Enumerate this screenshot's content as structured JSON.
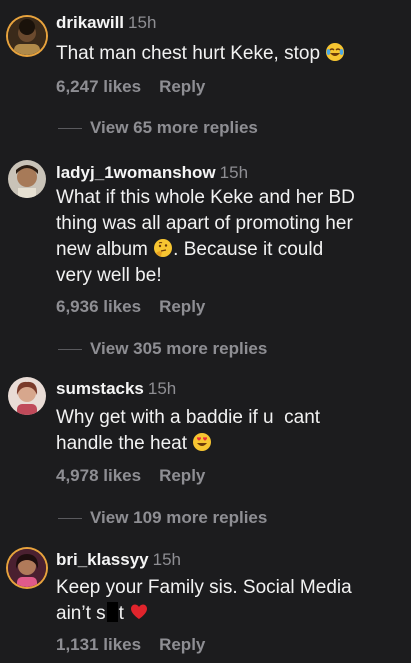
{
  "comments": [
    {
      "username": "drikawill",
      "time": "15h",
      "text": "That man chest hurt Keke, stop",
      "emoji": "face-with-tears-of-joy",
      "likes": "6,247 likes",
      "reply": "Reply",
      "view_more": "View 65 more replies"
    },
    {
      "username": "ladyj_1womanshow",
      "time": "15h",
      "text_line1": "What if this whole Keke and her BD",
      "text_line2": "thing was all apart of promoting her",
      "text_line3a": "new album",
      "emoji": "thinking-face",
      "text_line3b": ". Because it could",
      "text_line4": "very well be!",
      "likes": "6,936 likes",
      "reply": "Reply",
      "view_more": "View 305 more replies"
    },
    {
      "username": "sumstacks",
      "time": "15h",
      "text_line1": "Why get with a baddie if u  cant",
      "text_line2": "handle the heat",
      "emoji": "heart-eyes-face",
      "likes": "4,978 likes",
      "reply": "Reply",
      "view_more": "View 109 more replies"
    },
    {
      "username": "bri_klassyy",
      "time": "15h",
      "text_line1": "Keep your Family sis. Social Media",
      "text_line2a": "ain’t s",
      "text_line2b": "t",
      "emoji": "red-heart",
      "likes": "1,131 likes",
      "reply": "Reply"
    }
  ]
}
